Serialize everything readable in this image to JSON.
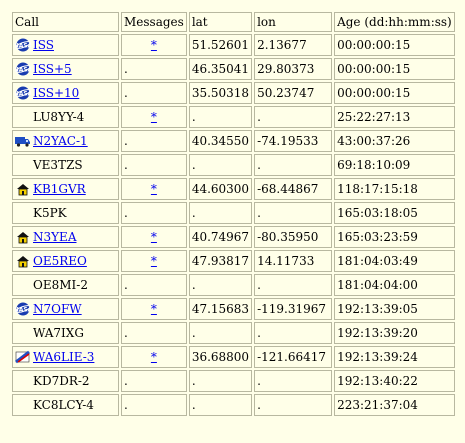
{
  "headers": {
    "call": "Call",
    "messages": "Messages",
    "lat": "lat",
    "lon": "lon",
    "age": "Age (dd:hh:mm:ss)"
  },
  "rows": [
    {
      "call": "ISS",
      "icon": "satellite-icon",
      "linked": true,
      "msg": "*",
      "lat": "51.52601",
      "lon": "2.13677",
      "age": "00:00:00:15"
    },
    {
      "call": "ISS+5",
      "icon": "satellite-icon",
      "linked": true,
      "msg": ".",
      "lat": "46.35041",
      "lon": "29.80373",
      "age": "00:00:00:15"
    },
    {
      "call": "ISS+10",
      "icon": "satellite-icon",
      "linked": true,
      "msg": ".",
      "lat": "35.50318",
      "lon": "50.23747",
      "age": "00:00:00:15"
    },
    {
      "call": "LU8YY-4",
      "icon": "",
      "linked": false,
      "msg": "*",
      "lat": ".",
      "lon": ".",
      "age": "25:22:27:13"
    },
    {
      "call": "N2YAC-1",
      "icon": "truck-icon",
      "linked": true,
      "msg": ".",
      "lat": "40.34550",
      "lon": "-74.19533",
      "age": "43:00:37:26"
    },
    {
      "call": "VE3TZS",
      "icon": "",
      "linked": false,
      "msg": ".",
      "lat": ".",
      "lon": ".",
      "age": "69:18:10:09"
    },
    {
      "call": "KB1GVR",
      "icon": "house-icon",
      "linked": true,
      "msg": "*",
      "lat": "44.60300",
      "lon": "-68.44867",
      "age": "118:17:15:18"
    },
    {
      "call": "K5PK",
      "icon": "",
      "linked": false,
      "msg": ".",
      "lat": ".",
      "lon": ".",
      "age": "165:03:18:05"
    },
    {
      "call": "N3YEA",
      "icon": "house-icon",
      "linked": true,
      "msg": "*",
      "lat": "40.74967",
      "lon": "-80.35950",
      "age": "165:03:23:59"
    },
    {
      "call": "OE5REO",
      "icon": "house-icon",
      "linked": true,
      "msg": "*",
      "lat": "47.93817",
      "lon": "14.11733",
      "age": "181:04:03:49"
    },
    {
      "call": "OE8MI-2",
      "icon": "",
      "linked": false,
      "msg": ".",
      "lat": ".",
      "lon": ".",
      "age": "181:04:04:00"
    },
    {
      "call": "N7OFW",
      "icon": "satellite-icon",
      "linked": true,
      "msg": "*",
      "lat": "47.15683",
      "lon": "-119.31967",
      "age": "192:13:39:05"
    },
    {
      "call": "WA7IXG",
      "icon": "",
      "linked": false,
      "msg": ".",
      "lat": ".",
      "lon": ".",
      "age": "192:13:39:20"
    },
    {
      "call": "WA6LIE-3",
      "icon": "flag-icon",
      "linked": true,
      "msg": "*",
      "lat": "36.68800",
      "lon": "-121.66417",
      "age": "192:13:39:24"
    },
    {
      "call": "KD7DR-2",
      "icon": "",
      "linked": false,
      "msg": ".",
      "lat": ".",
      "lon": ".",
      "age": "192:13:40:22"
    },
    {
      "call": "KC8LCY-4",
      "icon": "",
      "linked": false,
      "msg": ".",
      "lat": ".",
      "lon": ".",
      "age": "223:21:37:04"
    }
  ],
  "colors": {
    "background": "#ffffe8",
    "link": "#0000ee",
    "border": "#b8b8a0"
  }
}
